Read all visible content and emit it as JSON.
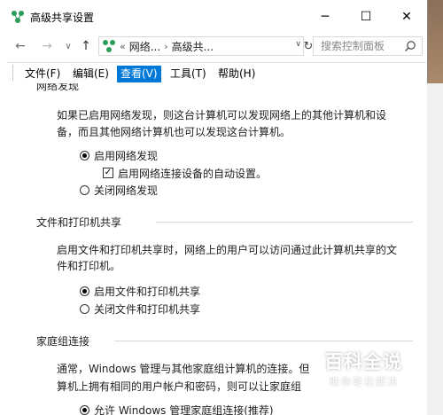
{
  "window": {
    "title": "高级共享设置",
    "minimize_symbol": "─",
    "maximize_symbol": "☐",
    "close_symbol": "✕"
  },
  "address_bar": {
    "back_symbol": "←",
    "forward_symbol": "→",
    "recent_symbol": "∨",
    "up_symbol": "↑",
    "prefix": "«",
    "crumbs": [
      "网络...",
      "高级共..."
    ],
    "separator": "›",
    "dropdown_symbol": "∨",
    "refresh_symbol": "↻",
    "search_placeholder": "搜索控制面板"
  },
  "menu": {
    "items": [
      {
        "label": "文件(F)"
      },
      {
        "label": "编辑(E)"
      },
      {
        "label": "查看(V)",
        "active": true
      },
      {
        "label": "工具(T)"
      },
      {
        "label": "帮助(H)"
      }
    ]
  },
  "sections": {
    "network_discovery": {
      "heading": "网络发现",
      "description_line1": "如果已启用网络发现，则这台计算机可以发现网络上的其他计算机和设",
      "description_line2": "备，而且其他网络计算机也可以发现这台计算机。",
      "option_on": "启用网络发现",
      "option_on_selected": true,
      "auto_setup": "启用网络连接设备的自动设置。",
      "auto_setup_checked": true,
      "option_off": "关闭网络发现"
    },
    "file_printer_sharing": {
      "heading": "文件和打印机共享",
      "description_line1": "启用文件和打印机共享时，网络上的用户可以访问通过此计算机共享的文",
      "description_line2": "件和打印机。",
      "option_on": "启用文件和打印机共享",
      "option_on_selected": true,
      "option_off": "关闭文件和打印机共享"
    },
    "homegroup": {
      "heading": "家庭组连接",
      "description_line1": "通常，Windows 管理与其他家庭组计算机的连接。但",
      "description_line2": "算机上拥有相同的用户帐户和密码，则可以让家庭组",
      "option_allow": "允许 Windows 管理家庭组连接(推荐)",
      "option_allow_selected": true
    }
  },
  "watermark": {
    "main": "百科全说",
    "sub": "助你轻松解决"
  },
  "colors": {
    "accent": "#0078d7",
    "app_icon_green": "#2e9d5b"
  }
}
